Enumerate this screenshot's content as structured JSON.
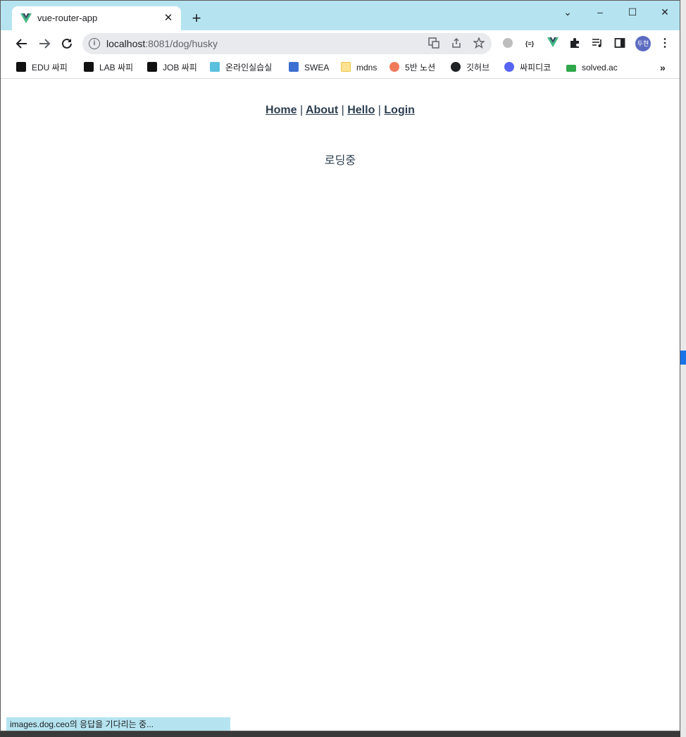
{
  "tab": {
    "title": "vue-router-app",
    "close": "✕"
  },
  "new_tab": "+",
  "window_controls": {
    "menu": "⌄",
    "minimize": "–",
    "maximize": "☐",
    "close": "✕"
  },
  "address": {
    "host": "localhost",
    "port_path": ":8081/dog/husky"
  },
  "profile": {
    "initials": "두현"
  },
  "bookmarks": [
    {
      "label": "EDU 싸피"
    },
    {
      "label": "LAB 싸피"
    },
    {
      "label": "JOB 싸피"
    },
    {
      "label": "온라인실습실"
    },
    {
      "label": "SWEA"
    },
    {
      "label": "mdns"
    },
    {
      "label": "5반 노션"
    },
    {
      "label": "깃허브"
    },
    {
      "label": "싸피디코"
    },
    {
      "label": "solved.ac"
    }
  ],
  "bookmarks_more": "»",
  "nav": {
    "home": "Home",
    "about": "About",
    "hello": "Hello",
    "login": "Login",
    "separator": "|"
  },
  "main": {
    "loading_text": "로딩중"
  },
  "status": {
    "text": "images.dog.ceo의 응답을 기다리는 중..."
  },
  "colors": {
    "titlebar": "#b5e4f0",
    "text": "#2c3e50"
  }
}
